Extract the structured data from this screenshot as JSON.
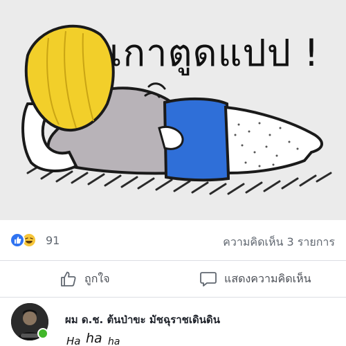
{
  "post_image": {
    "caption": "เกาตูดแปป !",
    "icon": "sticker-illustration"
  },
  "reactions": {
    "icons": [
      "like-icon",
      "haha-icon"
    ],
    "count": "91",
    "comments_count_label": "ความคิดเห็น 3 รายการ",
    "colors": {
      "like": "#2f73f1",
      "haha": "#f7c63a"
    }
  },
  "actions": {
    "like_label": "ถูกใจ",
    "comment_label": "แสดงความคิดเห็น"
  },
  "comment": {
    "author": "ผม ด.ช. ต้นป่าขะ มัชฉุราชเดินดิน",
    "sticker_words": [
      "Ha",
      "ha",
      "ha"
    ],
    "online": true
  }
}
